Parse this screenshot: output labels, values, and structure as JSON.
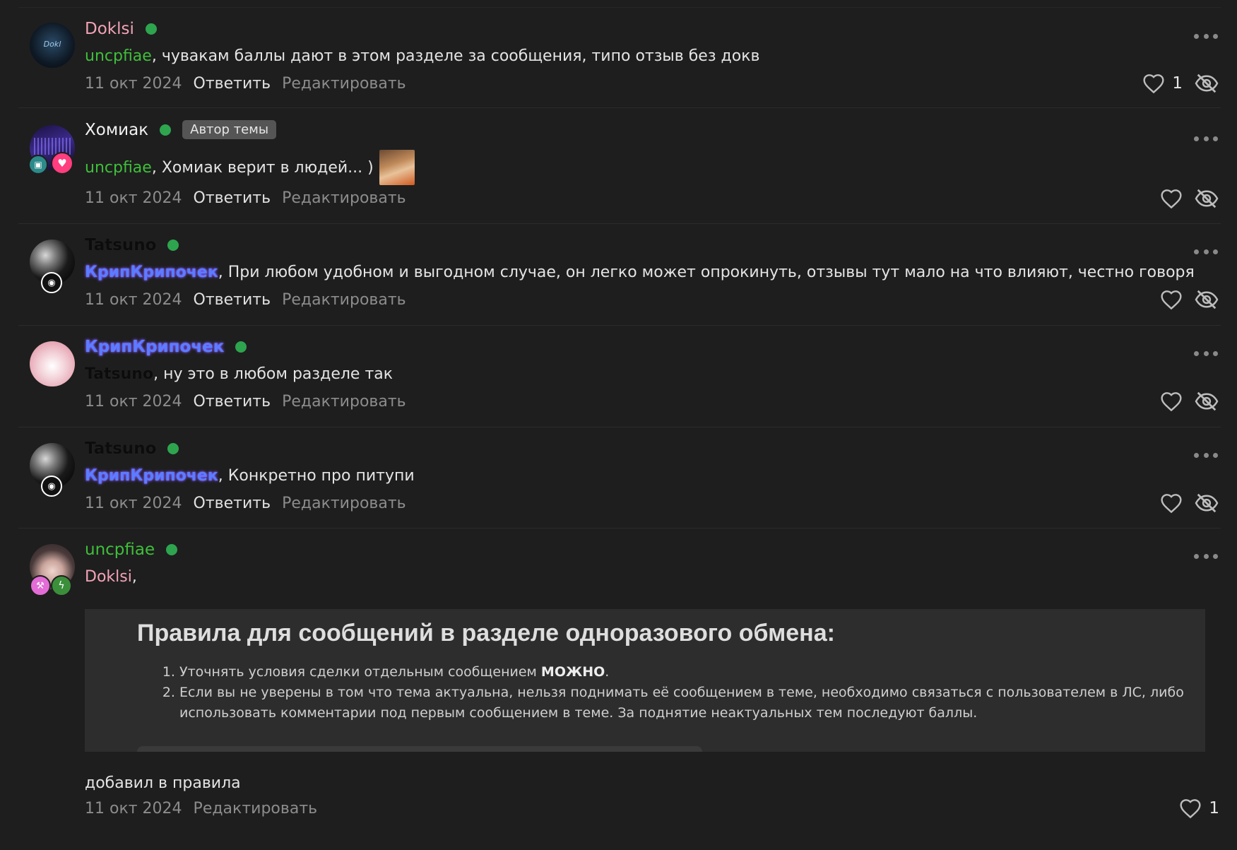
{
  "colors": {
    "background": "#1e1e1e",
    "online": "#2ea44f",
    "green_user": "#3fbf3a",
    "pink_user": "#f2a3b6",
    "blue_user": "#5a7dff"
  },
  "comments": [
    {
      "username": "Doklsi",
      "mention": "uncpfiae",
      "text": ", чувакам баллы дают в этом разделе за сообщения, типо отзыв без докв",
      "date": "11 окт 2024",
      "reply": "Ответить",
      "edit": "Редактировать",
      "likes": "1"
    },
    {
      "username": "Хомиак",
      "badge": "Автор темы",
      "mention": "uncpfiae",
      "text": ", Хомиак верит в людей... )",
      "date": "11 окт 2024",
      "reply": "Ответить",
      "edit": "Редактировать"
    },
    {
      "username": "Tatsuno",
      "mention": "КрипКрипочек",
      "text": ", При любом удобном и выгодном случае, он легко может опрокинуть, отзывы тут мало на что влияют, честно говоря",
      "date": "11 окт 2024",
      "reply": "Ответить",
      "edit": "Редактировать"
    },
    {
      "username": "КрипКрипочек",
      "mention": "Tatsuno",
      "text": ", ну это в любом разделе так",
      "date": "11 окт 2024",
      "reply": "Ответить",
      "edit": "Редактировать"
    },
    {
      "username": "Tatsuno",
      "mention": "КрипКрипочек",
      "text": ", Конкретно про питупи",
      "date": "11 окт 2024",
      "reply": "Ответить",
      "edit": "Редактировать"
    },
    {
      "username": "uncpfiae",
      "mention": "Doklsi",
      "text": ",",
      "rules_title": "Правила для сообщений в разделе одноразового обмена:",
      "rule1_text": "Уточнять условия сделки отдельным сообщением ",
      "rule1_bold": "МОЖНО",
      "rule1_end": ".",
      "rule2": "Если вы не уверены в том что тема актуальна, нельзя поднимать её сообщением в теме, необходимо связаться с пользователем в ЛС, либо использовать комментарии под первым сообщением в теме. За поднятие неактуальных тем последуют баллы.",
      "after_text": "добавил в правила",
      "date": "11 окт 2024",
      "edit": "Редактировать",
      "likes": "1"
    }
  ]
}
